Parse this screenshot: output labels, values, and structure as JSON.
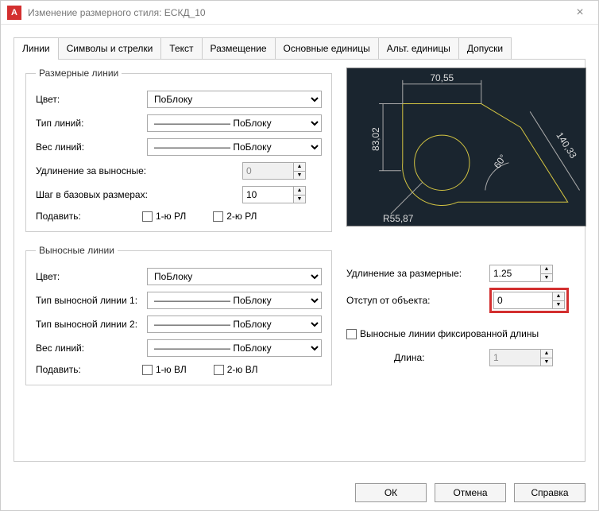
{
  "window": {
    "title": "Изменение размерного стиля: ЕСКД_10",
    "close_glyph": "×"
  },
  "tabs": {
    "lines": "Линии",
    "symbols": "Символы и стрелки",
    "text": "Текст",
    "fit": "Размещение",
    "primary": "Основные единицы",
    "alt": "Альт. единицы",
    "tol": "Допуски"
  },
  "dim_lines": {
    "legend": "Размерные линии",
    "color_label": "Цвет:",
    "color_value": "ПоБлоку",
    "linetype_label": "Тип линий:",
    "linetype_value": "ПоБлоку",
    "lineweight_label": "Вес линий:",
    "lineweight_value": "ПоБлоку",
    "extend_label": "Удлинение за выносные:",
    "extend_value": "0",
    "baseline_label": "Шаг в базовых размерах:",
    "baseline_value": "10",
    "suppress_label": "Подавить:",
    "suppress1": "1-ю РЛ",
    "suppress2": "2-ю РЛ"
  },
  "ext_lines": {
    "legend": "Выносные линии",
    "color_label": "Цвет:",
    "color_value": "ПоБлоку",
    "ext1type_label": "Тип выносной линии 1:",
    "ext1type_value": "ПоБлоку",
    "ext2type_label": "Тип выносной линии 2:",
    "ext2type_value": "ПоБлоку",
    "lineweight_label": "Вес линий:",
    "lineweight_value": "ПоБлоку",
    "suppress_label": "Подавить:",
    "suppress1": "1-ю ВЛ",
    "suppress2": "2-ю ВЛ",
    "extend_beyond_label": "Удлинение за размерные:",
    "extend_beyond_value": "1.25",
    "offset_label": "Отступ от объекта:",
    "offset_value": "0",
    "fixed_length_label": "Выносные линии фиксированной длины",
    "length_label": "Длина:",
    "length_value": "1"
  },
  "preview": {
    "dim_top": "70,55",
    "dim_left": "83,02",
    "dim_diag": "140,33",
    "dim_radius": "R55,87",
    "dim_angle": "60°"
  },
  "buttons": {
    "ok": "ОК",
    "cancel": "Отмена",
    "help": "Справка"
  }
}
